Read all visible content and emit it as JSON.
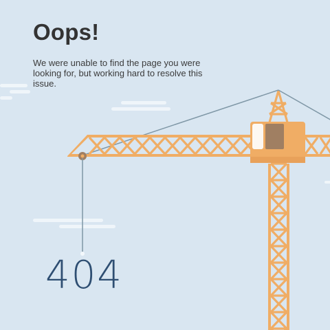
{
  "heading": "Oops!",
  "message": "We were unable to find the page you were looking for, but working hard to resolve this issue.",
  "error_code": "404",
  "colors": {
    "background": "#d9e6f1",
    "crane": "#f0ad65",
    "cabin_window": "#a07f62",
    "cable": "#7f97a6",
    "code_text": "#2e4e72",
    "cloud": "#ffffff"
  }
}
